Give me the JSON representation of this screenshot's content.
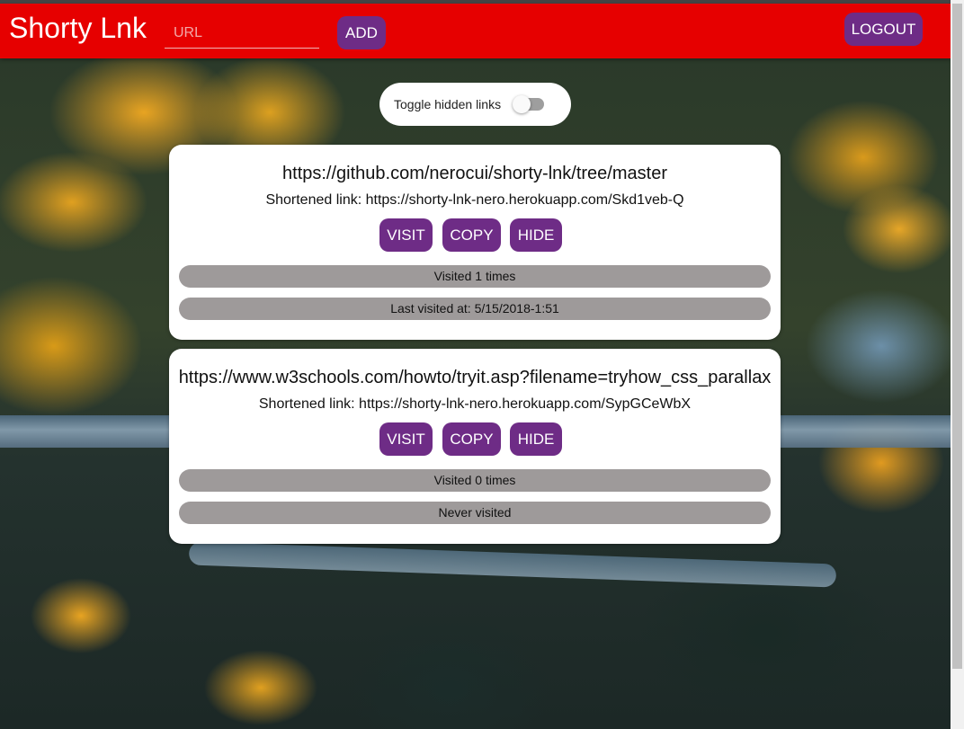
{
  "app": {
    "title": "Shorty Lnk"
  },
  "header": {
    "url_placeholder": "URL",
    "add_label": "ADD",
    "logout_label": "LOGOUT"
  },
  "toggle": {
    "label": "Toggle hidden links",
    "checked": false
  },
  "links": [
    {
      "url": "https://github.com/nerocui/shorty-lnk/tree/master",
      "shortened": "Shortened link: https://shorty-lnk-nero.herokuapp.com/Skd1veb-Q",
      "visit_label": "VISIT",
      "copy_label": "COPY",
      "hide_label": "HIDE",
      "visits": "Visited 1 times",
      "last_visited": "Last visited at: 5/15/2018-1:51"
    },
    {
      "url": "https://www.w3schools.com/howto/tryit.asp?filename=tryhow_css_parallax",
      "shortened": "Shortened link: https://shorty-lnk-nero.herokuapp.com/SypGCeWbX",
      "visit_label": "VISIT",
      "copy_label": "COPY",
      "hide_label": "HIDE",
      "visits": "Visited 0 times",
      "last_visited": "Never visited"
    }
  ],
  "colors": {
    "header": "#e60000",
    "button": "#6e2c86",
    "stat_bar": "#9e9a9a"
  }
}
